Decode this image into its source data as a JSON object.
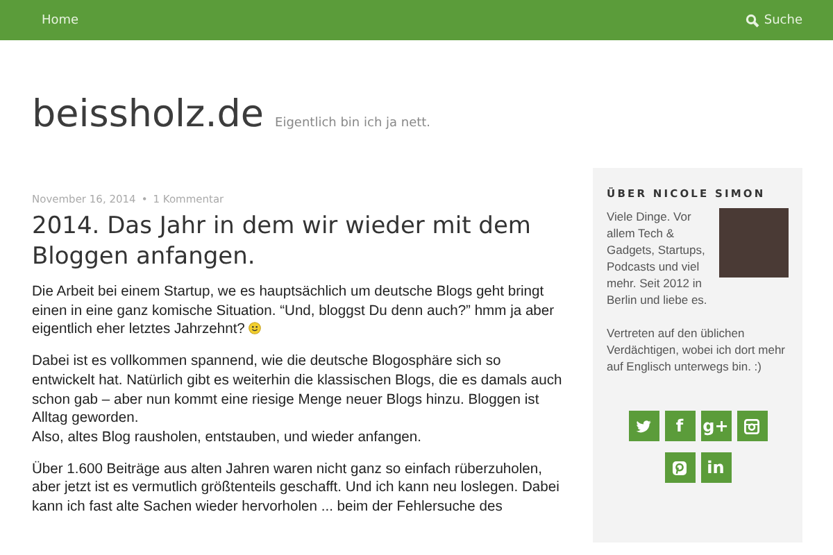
{
  "nav": {
    "items": [
      {
        "label": "Home"
      }
    ],
    "search": {
      "label": "Suche"
    }
  },
  "site": {
    "title": "beissholz.de",
    "tagline": "Eigentlich bin ich ja nett."
  },
  "post": {
    "date": "November 16, 2014",
    "separator": "•",
    "comments": "1 Kommentar",
    "title": "2014. Das Jahr in dem wir wieder mit dem Bloggen anfangen.",
    "paragraphs": [
      {
        "lines": [
          "Die Arbeit bei einem Startup, we es hauptsächlich um deutsche Blogs geht bringt einen in eine ganz komische Situation. “Und, bloggst Du denn auch?” hmm ja aber eigentlich eher letztes Jahrzehnt?"
        ],
        "smiley": true
      },
      {
        "lines": [
          "Dabei ist es vollkommen spannend, wie die deutsche Blogosphäre sich so entwickelt hat. Natürlich gibt es weiterhin die klassischen Blogs, die es damals auch schon gab – aber nun kommt eine riesige Menge neuer Blogs hinzu. Bloggen ist Alltag geworden.",
          "Also, altes Blog rausholen, entstauben, und wieder anfangen."
        ],
        "smiley": false
      },
      {
        "lines": [
          "Über 1.600 Beiträge aus alten Jahren waren nicht ganz so einfach rüberzuholen, aber jetzt ist es vermutlich größtenteils geschafft. Und ich kann neu loslegen. Dabei kann ich fast alte Sachen wieder hervorholen ... beim der Fehlersuche des"
        ],
        "smiley": false
      }
    ]
  },
  "sidebar": {
    "heading": "ÜBER NICOLE SIMON",
    "bio": "Viele Dinge. Vor allem Tech & Gadgets, Startups, Podcasts und viel mehr. Seit 2012 in Berlin und liebe es.",
    "note": "Vertreten auf den üblichen Verdächtigen, wobei ich dort mehr auf Englisch unterwegs bin. :)",
    "social": [
      {
        "kind": "twitter"
      },
      {
        "kind": "facebook",
        "label": "f"
      },
      {
        "kind": "googleplus",
        "label": "g+"
      },
      {
        "kind": "instagram"
      },
      {
        "kind": "pinterest"
      },
      {
        "kind": "linkedin",
        "label": "in"
      }
    ]
  }
}
